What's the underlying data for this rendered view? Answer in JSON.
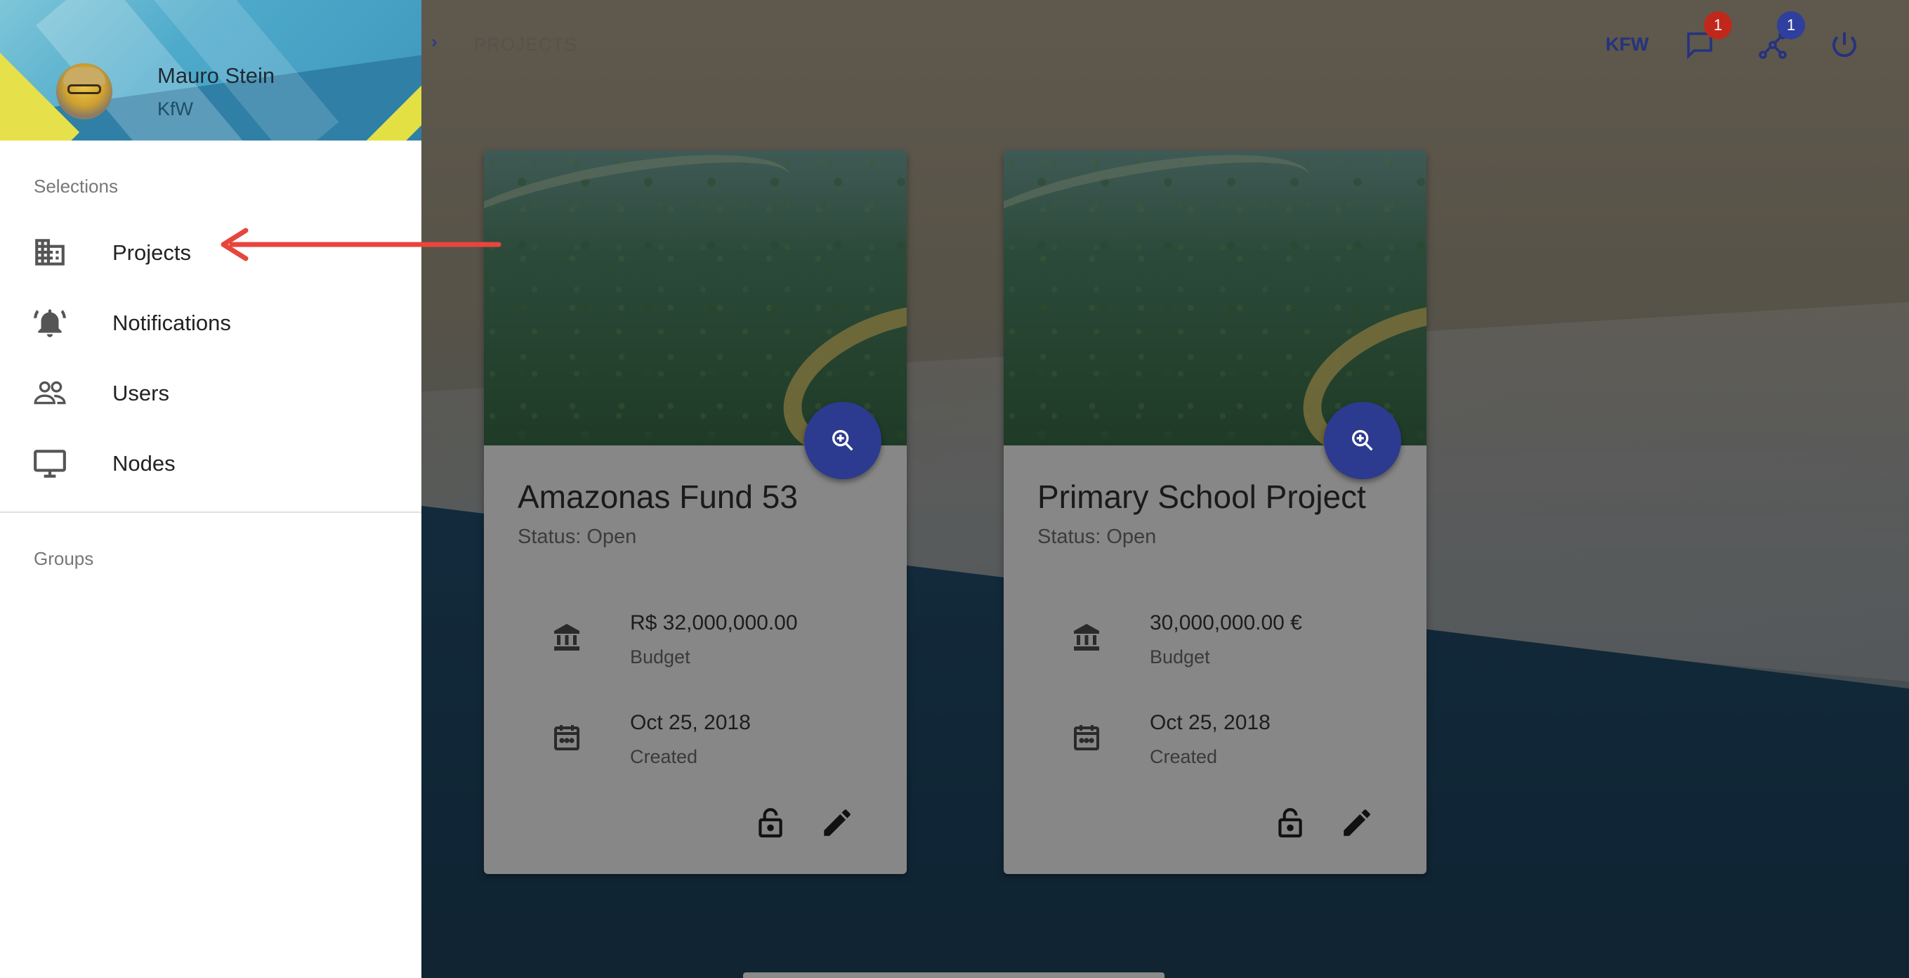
{
  "header": {
    "breadcrumb": "PROJECTS",
    "organization": "KFW",
    "notifications_count": "1",
    "network_count": "1",
    "icons": {
      "messages": "chat-icon",
      "network": "network-icon",
      "logout": "power-icon"
    }
  },
  "drawer": {
    "user": {
      "name": "Mauro Stein",
      "organization": "KfW"
    },
    "selections_label": "Selections",
    "groups_label": "Groups",
    "items": [
      {
        "label": "Projects",
        "icon": "building-icon"
      },
      {
        "label": "Notifications",
        "icon": "bell-icon"
      },
      {
        "label": "Users",
        "icon": "users-icon"
      },
      {
        "label": "Nodes",
        "icon": "monitor-icon"
      }
    ]
  },
  "projects": [
    {
      "title": "Amazonas Fund 53",
      "status": "Status: Open",
      "budget_value": "R$ 32,000,000.00",
      "budget_label": "Budget",
      "created_value": "Oct 25, 2018",
      "created_label": "Created"
    },
    {
      "title": "Primary School Project",
      "status": "Status: Open",
      "budget_value": "30,000,000.00 €",
      "budget_label": "Budget",
      "created_value": "Oct 25, 2018",
      "created_label": "Created"
    }
  ],
  "colors": {
    "accent": "#2c3a8f",
    "badge_red": "#c0281c",
    "badge_blue": "#2e3f9e",
    "annotation_arrow": "#e8453c"
  }
}
